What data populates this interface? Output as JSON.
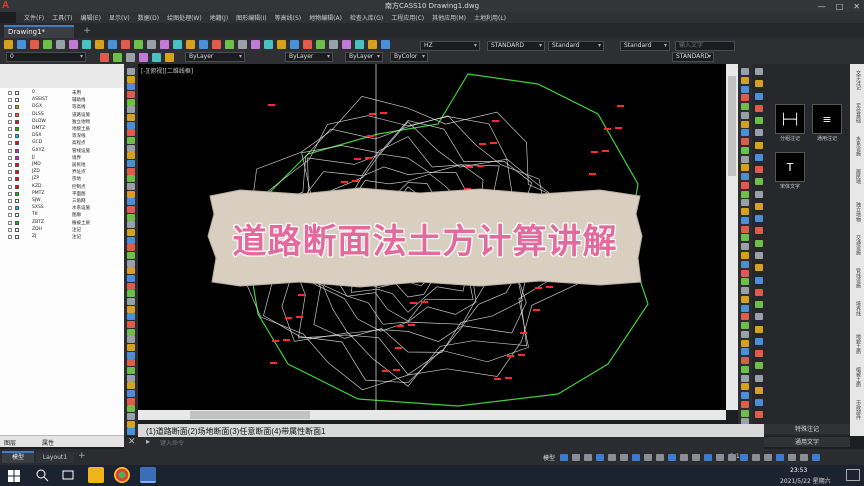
{
  "app": {
    "title": "南方CASS10   Drawing1.dwg",
    "logo": "A",
    "window_controls": [
      "—",
      "□",
      "✕"
    ]
  },
  "menu": [
    "文件(F)",
    "工具(T)",
    "编辑(E)",
    "显示(V)",
    "数据(D)",
    "绘图处理(W)",
    "地籍(J)",
    "图形编辑(I)",
    "等高线(S)",
    "地物编辑(A)",
    "检查入库(G)",
    "工程应用(C)",
    "其他应用(M)",
    "土地利用(L)"
  ],
  "doc_tabs": {
    "active": "Drawing1*",
    "add": "+"
  },
  "toolbar": {
    "layer_combo": "0",
    "color_combo": "ByLayer",
    "linetype_combo": "ByLayer",
    "lineweight_combo": "ByColor",
    "text_height": "HZ",
    "text_style": "STANDARD",
    "dim_style": "Standard",
    "table_style": "Standard",
    "search_placeholder": "输入文字",
    "plot_style": "STANDARD"
  },
  "viewport_label": "[-][俯视][二维线框]",
  "layers": [
    {
      "name": "0",
      "desc": "未用",
      "color": "#ffffff"
    },
    {
      "name": "ASSIST",
      "desc": "辅助线",
      "color": "#ffffff"
    },
    {
      "name": "DGX",
      "desc": "等高线",
      "color": "#c8a000"
    },
    {
      "name": "DLSS",
      "desc": "道路设施",
      "color": "#ff6000"
    },
    {
      "name": "DLDW",
      "desc": "独立地物",
      "color": "#ff0000"
    },
    {
      "name": "DMTZ",
      "desc": "地貌土质",
      "color": "#00c000"
    },
    {
      "name": "DSX",
      "desc": "等深线",
      "color": "#00c0ff"
    },
    {
      "name": "GCD",
      "desc": "高程点",
      "color": "#ff0000"
    },
    {
      "name": "GXYZ",
      "desc": "管线设施",
      "color": "#ff00ff"
    },
    {
      "name": "JJ",
      "desc": "境界",
      "color": "#ff00ff"
    },
    {
      "name": "JMD",
      "desc": "居民地",
      "color": "#ff0000"
    },
    {
      "name": "JZD",
      "desc": "界址点",
      "color": "#ff0000"
    },
    {
      "name": "JZP",
      "desc": "宗地",
      "color": "#ff0000"
    },
    {
      "name": "KZD",
      "desc": "控制点",
      "color": "#ff0000"
    },
    {
      "name": "PMTZ",
      "desc": "平面图",
      "color": "#00c000"
    },
    {
      "name": "SJW",
      "desc": "三角网",
      "color": "#ffffff"
    },
    {
      "name": "SXSS",
      "desc": "水系设施",
      "color": "#00c0ff"
    },
    {
      "name": "TK",
      "desc": "图廓",
      "color": "#ffffff"
    },
    {
      "name": "ZBTZ",
      "desc": "植被土质",
      "color": "#00c000"
    },
    {
      "name": "ZDH",
      "desc": "注记",
      "color": "#ffffff"
    },
    {
      "name": "ZJ",
      "desc": "注记",
      "color": "#ffffff"
    }
  ],
  "layer_footer": [
    "图层",
    "属性"
  ],
  "overlay_title": "道路断面法土方计算讲解",
  "right_panel": {
    "styles": [
      {
        "label": "分组注记",
        "glyph": "├─┤"
      },
      {
        "label": "通用注记",
        "glyph": "≡"
      },
      {
        "label": "宋体文字",
        "glyph": "T"
      }
    ],
    "bottom": [
      "特殊注记",
      "通用文字"
    ],
    "tabs": [
      "文字注记",
      "定位基础",
      "水系设施",
      "居民地",
      "独立地物",
      "交通设施",
      "管线设施",
      "境界线",
      "地貌土质",
      "植被土质",
      "市政部件"
    ]
  },
  "command": {
    "history": "(1)道路断面(2)场地断面(3)任意断面(4)带属性断面1",
    "placeholder": "键入命令"
  },
  "layout_tabs": {
    "model": "模型",
    "layout1": "Layout1",
    "add": "+"
  },
  "status": {
    "model": "模型",
    "scale": "1:1"
  },
  "clock": {
    "time": "23:53",
    "date": "2021/5/22 星期六"
  },
  "colors": {
    "accent": "#3d7bd1",
    "contour": "#e8e8e8",
    "boundary": "#3fcf3a",
    "elev_points": "#ff2a2a",
    "overlay_text": "#e36a9c",
    "paper": "#d9cfc0"
  }
}
